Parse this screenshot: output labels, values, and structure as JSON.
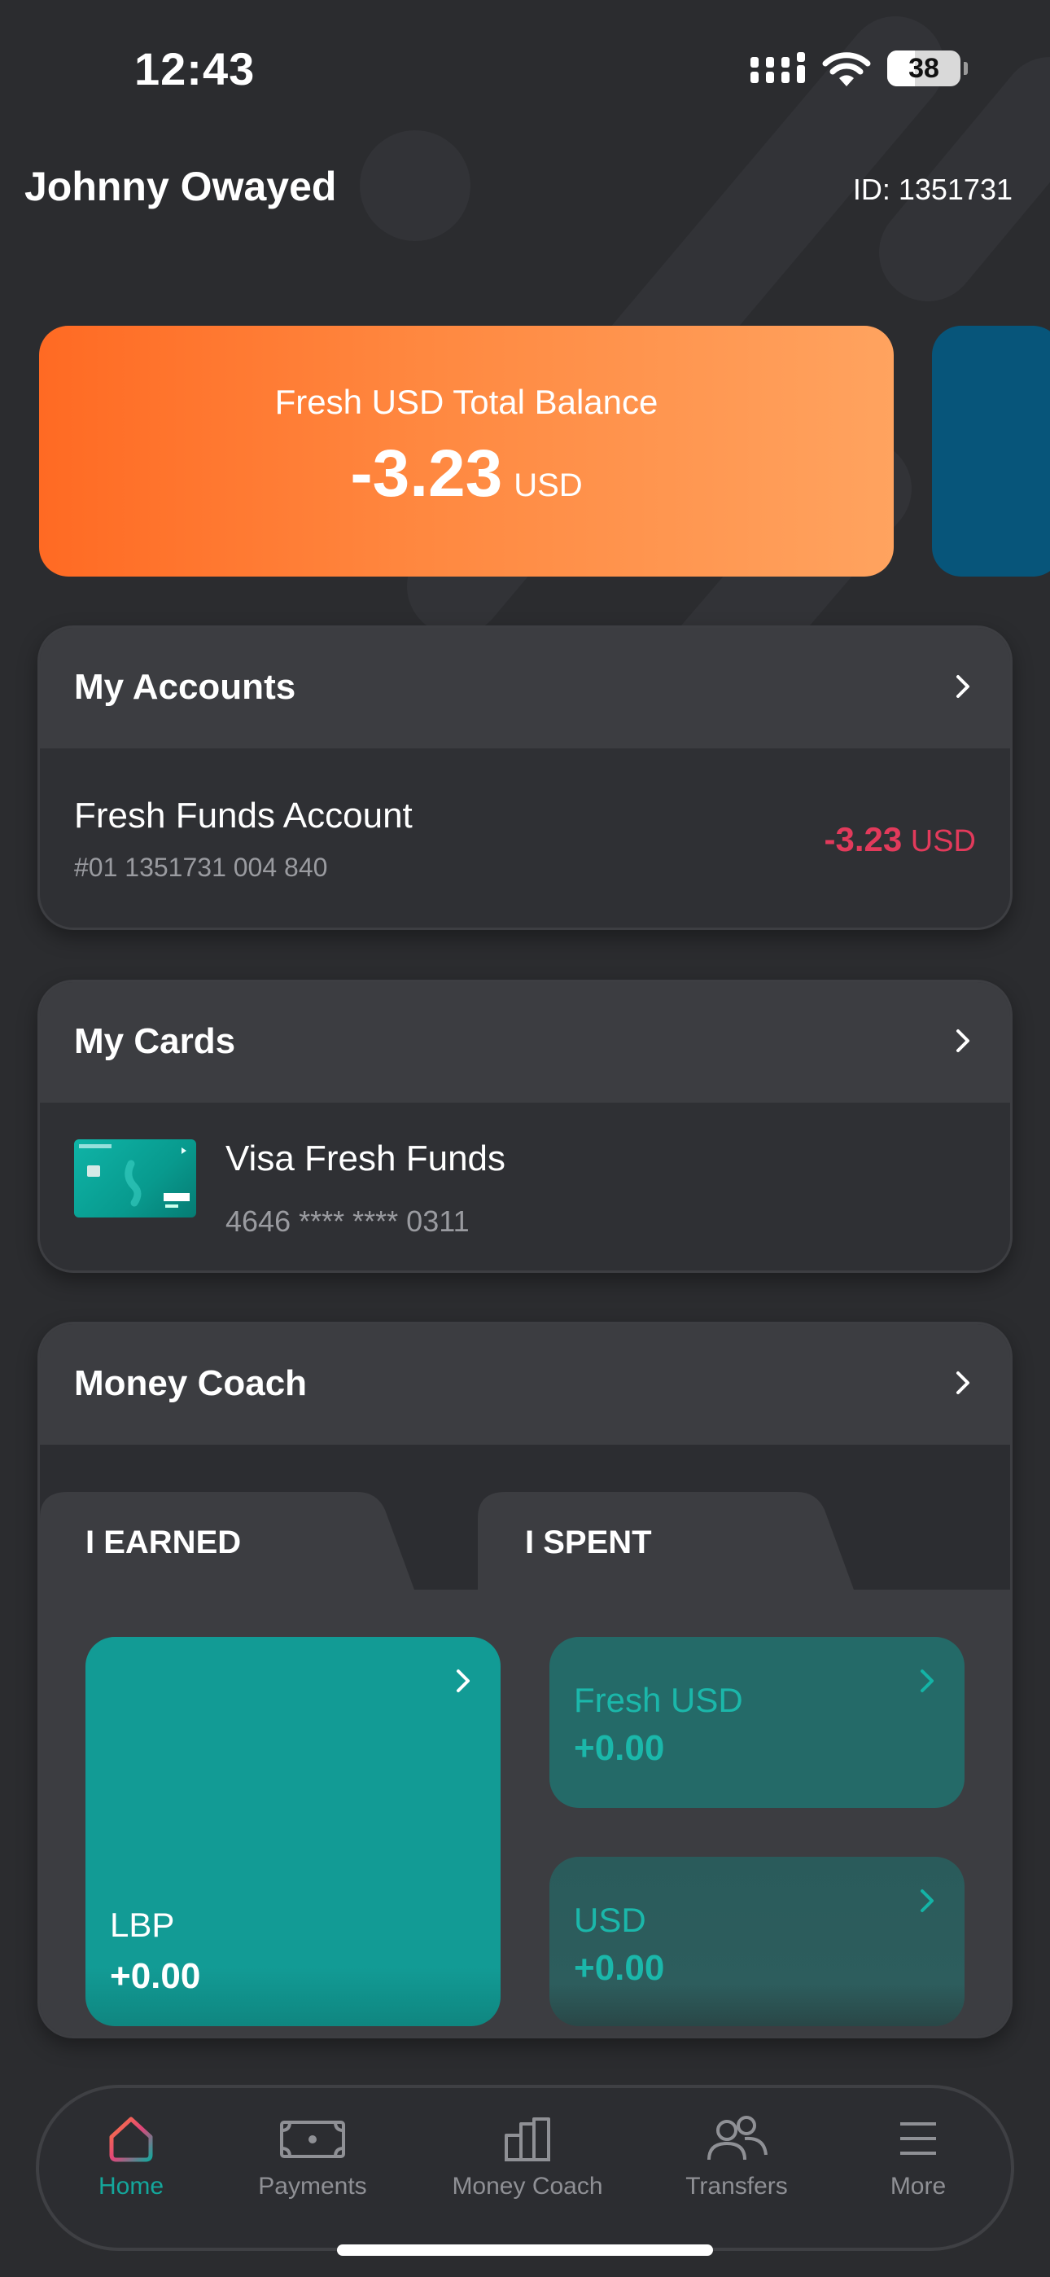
{
  "status_bar": {
    "time": "12:43",
    "battery": "38"
  },
  "header": {
    "user_name": "Johnny Owayed",
    "user_id": "ID: 1351731"
  },
  "balance_card": {
    "label": "Fresh USD Total Balance",
    "amount": "-3.23",
    "currency": "USD"
  },
  "accounts": {
    "title": "My Accounts",
    "items": [
      {
        "name": "Fresh Funds Account",
        "number": "#01 1351731 004 840",
        "balance": "-3.23",
        "currency": "USD"
      }
    ]
  },
  "cards": {
    "title": "My Cards",
    "items": [
      {
        "name": "Visa Fresh Funds",
        "number": "4646 **** **** 0311"
      }
    ]
  },
  "money_coach": {
    "title": "Money Coach",
    "tabs": [
      {
        "label": "I EARNED",
        "active": true
      },
      {
        "label": "I SPENT",
        "active": false
      }
    ],
    "tiles": [
      {
        "label": "LBP",
        "value": "+0.00"
      },
      {
        "label": "Fresh USD",
        "value": "+0.00"
      },
      {
        "label": "USD",
        "value": "+0.00"
      }
    ]
  },
  "nav": {
    "items": [
      {
        "label": "Home",
        "icon": "home-icon",
        "active": true
      },
      {
        "label": "Payments",
        "icon": "banknote-icon",
        "active": false
      },
      {
        "label": "Money Coach",
        "icon": "bar-chart-icon",
        "active": false
      },
      {
        "label": "Transfers",
        "icon": "users-icon",
        "active": false
      },
      {
        "label": "More",
        "icon": "menu-icon",
        "active": false
      }
    ]
  },
  "colors": {
    "background": "#2b2c2f",
    "accent_teal": "#14a79c",
    "balance_orange": "#ff7a30",
    "negative_red": "#e23a5b"
  }
}
